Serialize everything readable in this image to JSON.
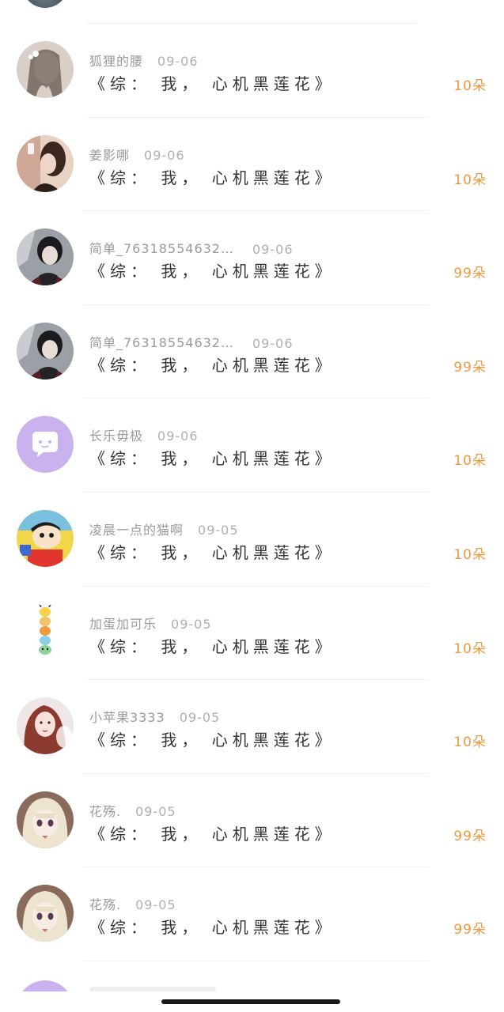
{
  "donations": [
    {
      "name": "狐狸的腰",
      "date": "09-06",
      "title": "《综： 我， 心机黑莲花》",
      "amount": "10朵",
      "avatar": "girl-pale-avatar"
    },
    {
      "name": "姜影哪",
      "date": "09-06",
      "title": "《综： 我， 心机黑莲花》",
      "amount": "10朵",
      "avatar": "girl-selfie-avatar"
    },
    {
      "name": "简单_76318554632…",
      "date": "09-06",
      "title": "《综： 我， 心机黑莲花》",
      "amount": "99朵",
      "avatar": "anime-boy-avatar"
    },
    {
      "name": "简单_76318554632…",
      "date": "09-06",
      "title": "《综： 我， 心机黑莲花》",
      "amount": "99朵",
      "avatar": "anime-boy-avatar"
    },
    {
      "name": "长乐毋极",
      "date": "09-06",
      "title": "《综： 我， 心机黑莲花》",
      "amount": "10朵",
      "avatar": "default-chat-avatar"
    },
    {
      "name": "凌晨一点的猫啊",
      "date": "09-05",
      "title": "《综： 我， 心机黑莲花》",
      "amount": "10朵",
      "avatar": "cartoon-kid-avatar"
    },
    {
      "name": "加蛋加可乐",
      "date": "09-05",
      "title": "《综： 我， 心机黑莲花》",
      "amount": "10朵",
      "avatar": "pokemon-stack-avatar"
    },
    {
      "name": "小苹果3333",
      "date": "09-05",
      "title": "《综： 我， 心机黑莲花》",
      "amount": "10朵",
      "avatar": "girl-redhair-avatar"
    },
    {
      "name": "花殇.",
      "date": "09-05",
      "title": "《综： 我， 心机黑莲花》",
      "amount": "99朵",
      "avatar": "anime-girl-avatar"
    },
    {
      "name": "花殇.",
      "date": "09-05",
      "title": "《综： 我， 心机黑莲花》",
      "amount": "99朵",
      "avatar": "anime-girl-avatar"
    }
  ],
  "colors": {
    "amount": "#f0983f",
    "name": "#9a9a9a",
    "title": "#333333",
    "default_avatar": "#c9b2ee"
  }
}
